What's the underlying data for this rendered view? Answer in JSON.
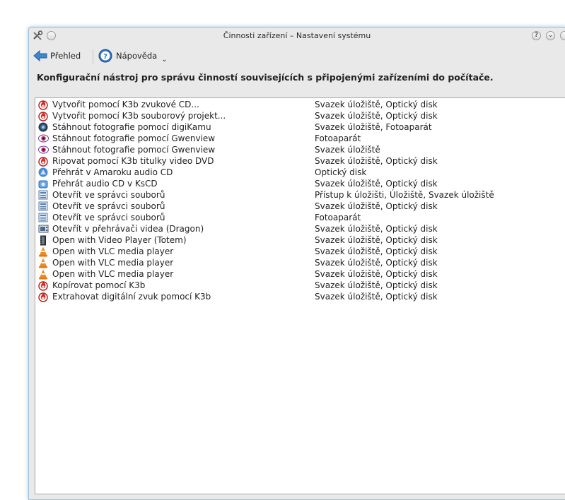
{
  "window": {
    "title": "Činnosti zařízení – Nastavení systému"
  },
  "toolbar": {
    "overview_label": "Přehled",
    "help_label": "Nápověda"
  },
  "heading": "Konfigurační nástroj pro správu činností souvisejících s připojenými zařízeními do počítače.",
  "actions": [
    {
      "icon": "k3b-icon",
      "name": "Vytvořit pomocí K3b zvukové CD...",
      "devices": "Svazek úložiště, Optický disk"
    },
    {
      "icon": "k3b-icon",
      "name": "Vytvořit pomocí K3b souborový projekt...",
      "devices": "Svazek úložiště, Optický disk"
    },
    {
      "icon": "digikam-icon",
      "name": "Stáhnout fotografie pomocí digiKamu",
      "devices": "Svazek úložiště, Fotoaparát"
    },
    {
      "icon": "gwenview-icon",
      "name": "Stáhnout fotografie pomocí Gwenview",
      "devices": "Fotoaparát"
    },
    {
      "icon": "gwenview-icon",
      "name": "Stáhnout fotografie pomocí Gwenview",
      "devices": "Svazek úložiště"
    },
    {
      "icon": "k3b-icon",
      "name": "Ripovat pomocí K3b titulky video DVD",
      "devices": "Svazek úložiště, Optický disk"
    },
    {
      "icon": "amarok-icon",
      "name": "Přehrát v Amaroku audio CD",
      "devices": "Optický disk"
    },
    {
      "icon": "kscd-icon",
      "name": "Přehrát audio CD v KsCD",
      "devices": "Svazek úložiště, Optický disk"
    },
    {
      "icon": "file-manager-icon",
      "name": "Otevřít ve správci souborů",
      "devices": "Přístup k úložišti, Úložiště, Svazek úložiště"
    },
    {
      "icon": "file-manager-icon",
      "name": "Otevřít ve správci souborů",
      "devices": "Svazek úložiště, Optický disk"
    },
    {
      "icon": "file-manager-icon",
      "name": "Otevřít ve správci souborů",
      "devices": "Fotoaparát"
    },
    {
      "icon": "dragon-player-icon",
      "name": "Otevřít v přehrávači videa (Dragon)",
      "devices": "Svazek úložiště, Optický disk"
    },
    {
      "icon": "totem-icon",
      "name": "Open with Video Player (Totem)",
      "devices": "Svazek úložiště, Optický disk"
    },
    {
      "icon": "vlc-icon",
      "name": "Open with VLC media player",
      "devices": "Svazek úložiště, Optický disk"
    },
    {
      "icon": "vlc-icon",
      "name": "Open with VLC media player",
      "devices": "Svazek úložiště, Optický disk"
    },
    {
      "icon": "vlc-icon",
      "name": "Open with VLC media player",
      "devices": "Svazek úložiště, Optický disk"
    },
    {
      "icon": "k3b-icon",
      "name": "Kopírovat pomocí K3b",
      "devices": "Svazek úložiště, Optický disk"
    },
    {
      "icon": "k3b-icon",
      "name": "Extrahovat digitální zvuk pomocí K3b",
      "devices": "Svazek úložiště, Optický disk"
    }
  ]
}
